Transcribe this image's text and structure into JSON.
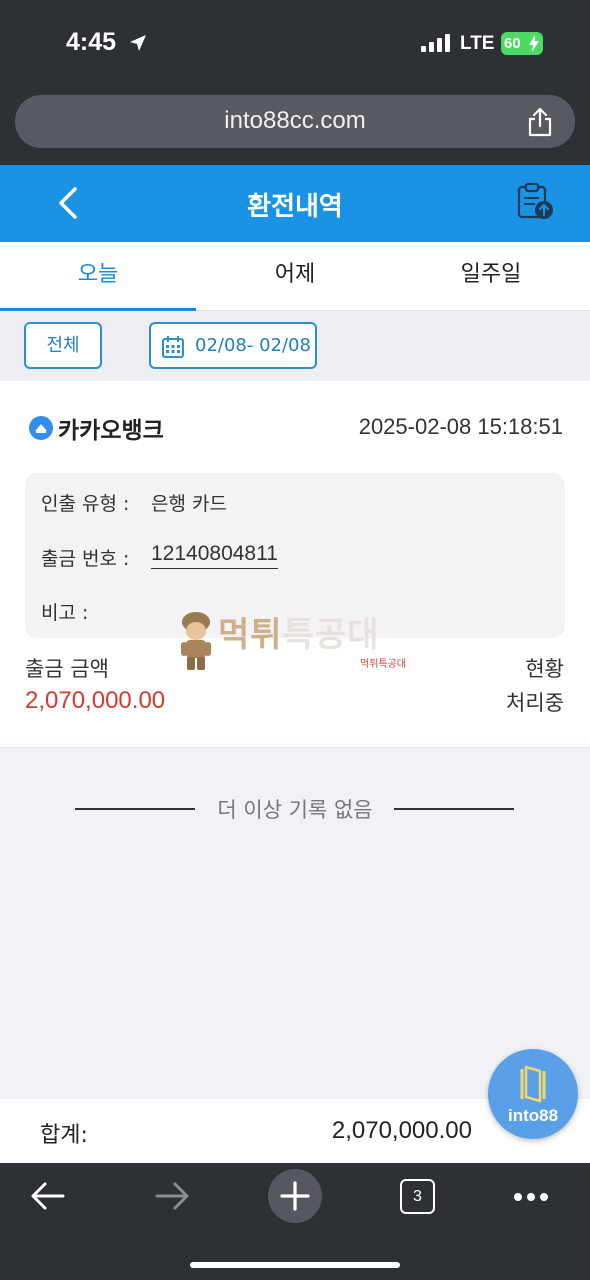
{
  "status_bar": {
    "time": "4:45",
    "network": "LTE",
    "battery": "60"
  },
  "browser": {
    "url": "into88cc.com",
    "open_tabs": "3"
  },
  "header": {
    "title": "환전내역"
  },
  "tabs": [
    {
      "label": "오늘",
      "active": true
    },
    {
      "label": "어제",
      "active": false
    },
    {
      "label": "일주일",
      "active": false
    }
  ],
  "filter": {
    "all_label": "전체",
    "date_range": "02/08- 02/08"
  },
  "record": {
    "bank_name": "카카오뱅크",
    "datetime": "2025-02-08 15:18:51",
    "withdraw_type_label": "인출 유형 :",
    "withdraw_type_value": "은행 카드",
    "withdraw_number_label": "출금 번호 :",
    "withdraw_number_value": "12140804811",
    "note_label": "비고 :",
    "amount_label": "출금 금액",
    "amount_value": "2,070,000.00",
    "status_label": "현황",
    "status_value": "처리중"
  },
  "watermark": {
    "main": "먹튀",
    "faded": "특공대",
    "sub": "먹튀특공대"
  },
  "end_of_list": "더 이상 기록 없음",
  "total": {
    "label": "합계:",
    "value": "2,070,000.00"
  },
  "fab": {
    "label": "into88"
  },
  "colors": {
    "header_blue": "#1a93e5",
    "tab_active": "#1a8ad6",
    "amount_red": "#d63a2e",
    "browser_chrome": "#2d3035"
  }
}
